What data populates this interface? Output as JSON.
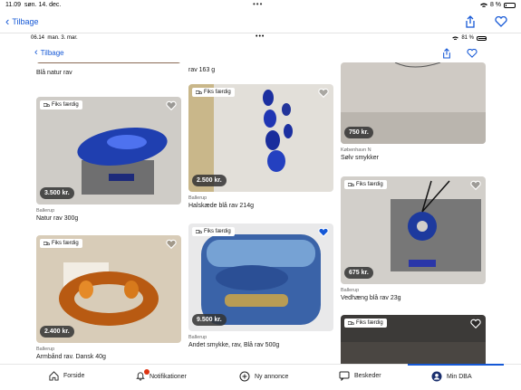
{
  "outer_status": {
    "time": "11.09",
    "date": "søn. 14. dec.",
    "battery": "8 %"
  },
  "outer_nav": {
    "back_label": "Tilbage"
  },
  "inner_status": {
    "time": "06.14",
    "date": "man. 3. mar.",
    "battery": "81 %"
  },
  "inner_nav": {
    "back_label": "Tilbage"
  },
  "listings": {
    "col1": [
      {
        "location": "",
        "title": "Blå natur rav",
        "price": "",
        "badge": ""
      },
      {
        "location": "Ballerup",
        "title": "Natur rav 300g",
        "price": "3.500 kr.",
        "badge": "Fiks færdig"
      },
      {
        "location": "Ballerup",
        "title": "Armbånd rav. Dansk 40g",
        "price": "2.400 kr.",
        "badge": "Fiks færdig"
      }
    ],
    "col2": [
      {
        "location": "",
        "title": "rav 163 g",
        "price": "",
        "badge": ""
      },
      {
        "location": "Ballerup",
        "title": "Halskæde blå rav 214g",
        "price": "2.500 kr.",
        "badge": "Fiks færdig"
      },
      {
        "location": "Ballerup",
        "title": "Andet smykke, rav, Blå rav 500g",
        "price": "9.500 kr.",
        "badge": "Fiks færdig"
      }
    ],
    "col3": [
      {
        "location": "København N",
        "title": "Sølv smykker",
        "price": "750 kr.",
        "badge": ""
      },
      {
        "location": "Ballerup",
        "title": "Vedhæng blå rav 23g",
        "price": "675 kr.",
        "badge": "Fiks færdig"
      },
      {
        "location": "",
        "title": "",
        "price": "",
        "badge": "Fiks færdig"
      }
    ]
  },
  "tabbar": {
    "forside": "Forside",
    "notifikationer": "Notifikationer",
    "ny_annonce": "Ny annonce",
    "beskeder": "Beskeder",
    "min_dba": "Min DBA"
  },
  "colors": {
    "accent": "#1558d6",
    "favorite_selected": "#1558d6"
  }
}
